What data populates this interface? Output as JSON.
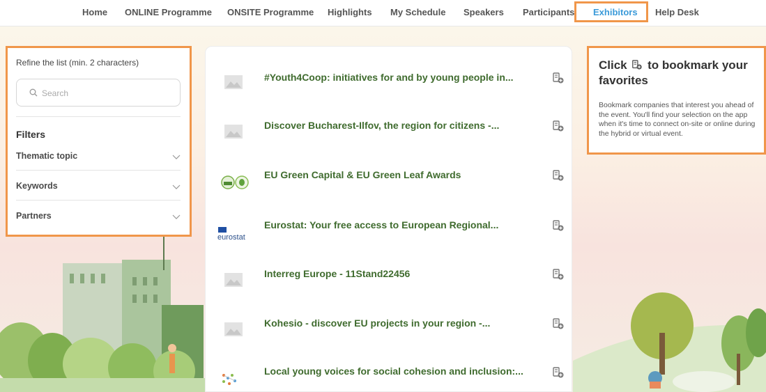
{
  "nav": {
    "items": [
      {
        "label": "Home"
      },
      {
        "label": "ONLINE Programme"
      },
      {
        "label": "ONSITE Programme"
      },
      {
        "label": "Highlights"
      },
      {
        "label": "My Schedule"
      },
      {
        "label": "Speakers"
      },
      {
        "label": "Participants"
      },
      {
        "label": "Exhibitors"
      },
      {
        "label": "Help Desk"
      }
    ],
    "active": "Exhibitors"
  },
  "filters": {
    "refine_label": "Refine the list (min. 2 characters)",
    "search_placeholder": "Search",
    "heading": "Filters",
    "items": [
      {
        "label": "Thematic topic"
      },
      {
        "label": "Keywords"
      },
      {
        "label": "Partners"
      }
    ]
  },
  "exhibitors": [
    {
      "title": "#Youth4Coop: initiatives for and by young people in...",
      "logo": "placeholder-image-icon"
    },
    {
      "title": "Discover Bucharest-Ilfov, the region for citizens -...",
      "logo": "placeholder-image-icon"
    },
    {
      "title": "EU Green Capital & EU Green Leaf Awards",
      "logo": "green-capital-logo"
    },
    {
      "title": "Eurostat: Your free access to European Regional...",
      "logo": "eurostat-logo",
      "logo_text": "eurostat"
    },
    {
      "title": "Interreg Europe - 11Stand22456",
      "logo": "placeholder-image-icon"
    },
    {
      "title": "Kohesio - discover EU projects in your region -...",
      "logo": "placeholder-image-icon"
    },
    {
      "title": "Local young voices for social cohesion and inclusion:...",
      "logo": "network-dots-logo"
    }
  ],
  "tip": {
    "title_before": "Click",
    "title_after": "to bookmark your favorites",
    "body": "Bookmark companies that interest you ahead of the event. You'll find your selection on the app when it's time to connect on-site or online during the hybrid or virtual event."
  },
  "colors": {
    "accent": "#3a9ad9",
    "highlight": "#f0964a",
    "title_green": "#3f6b2e"
  }
}
